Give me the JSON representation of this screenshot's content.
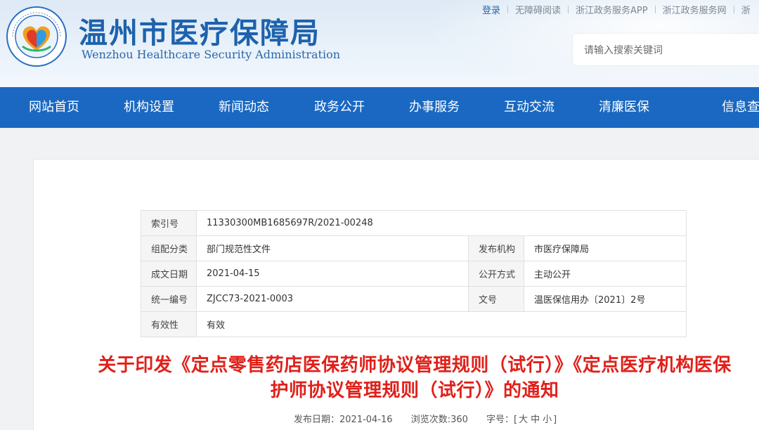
{
  "header": {
    "title": "温州市医疗保障局",
    "subtitle": "Wenzhou Healthcare Security Administration",
    "logo_ring_text": "Wenzhou Medical Security Bureau",
    "logo_text": "温州市医疗保障局"
  },
  "top_links": {
    "login": "登录",
    "accessible": "无障碍阅读",
    "app": "浙江政务服务APP",
    "web": "浙江政务服务网",
    "more": "浙"
  },
  "search": {
    "placeholder": "请输入搜索关键词"
  },
  "nav": {
    "items": [
      "网站首页",
      "机构设置",
      "新闻动态",
      "政务公开",
      "办事服务",
      "互动交流",
      "清廉医保",
      "信息查"
    ]
  },
  "meta": {
    "index_label": "索引号",
    "index_value": "11330300MB1685697R/2021-00248",
    "category_label": "组配分类",
    "category_value": "部门规范性文件",
    "publisher_label": "发布机构",
    "publisher_value": "市医疗保障局",
    "date_label": "成文日期",
    "date_value": "2021-04-15",
    "open_label": "公开方式",
    "open_value": "主动公开",
    "code_label": "统一编号",
    "code_value": "ZJCC73-2021-0003",
    "docno_label": "文号",
    "docno_value": "温医保信用办〔2021〕2号",
    "validity_label": "有效性",
    "validity_value": "有效"
  },
  "document": {
    "title_line1": "关于印发《定点零售药店医保药师协议管理规则（试行）》《定点医疗机构医保",
    "title_line2": "护师协议管理规则（试行）》的通知",
    "publish_date": "发布日期：2021-04-16",
    "views": "浏览次数:360",
    "font_size_label": "字号：[",
    "font_large": "大",
    "font_medium": "中",
    "font_small": "小",
    "font_size_end": "]"
  },
  "colors": {
    "brand_blue": "#1a68c1",
    "title_red": "#e0201a",
    "title_blue": "#1d62ad"
  }
}
